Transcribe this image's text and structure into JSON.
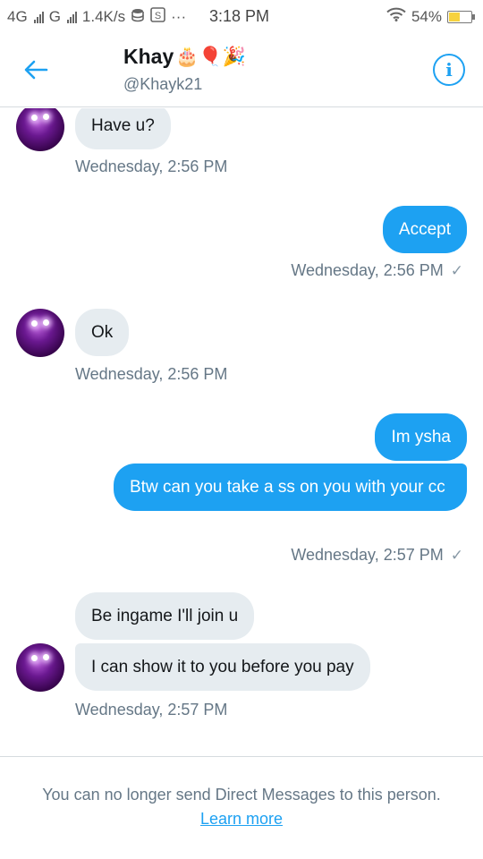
{
  "status_bar": {
    "network_1": "4G",
    "network_2": "G",
    "speed": "1.4K/s",
    "dots": "···",
    "time": "3:18 PM",
    "battery": "54%",
    "battery_level": 0.54
  },
  "header": {
    "name": "Khay",
    "name_emojis": "🎂🎈🎉",
    "handle": "@Khayk21"
  },
  "messages": [
    {
      "direction": "in",
      "text": "Have u?"
    },
    {
      "direction": "in",
      "timestamp": "Wednesday, 2:56 PM"
    },
    {
      "direction": "out",
      "text": "Accept"
    },
    {
      "direction": "out",
      "timestamp": "Wednesday, 2:56 PM"
    },
    {
      "direction": "in",
      "text": "Ok"
    },
    {
      "direction": "in",
      "timestamp": "Wednesday, 2:56 PM"
    },
    {
      "direction": "out",
      "text": "Im ysha"
    },
    {
      "direction": "out",
      "text": "Btw can you take a ss on you with your cc"
    },
    {
      "direction": "out",
      "timestamp": "Wednesday, 2:57 PM"
    },
    {
      "direction": "in",
      "text": "Be ingame I'll join u"
    },
    {
      "direction": "in",
      "text": "I can show it to you before you pay"
    },
    {
      "direction": "in",
      "timestamp": "Wednesday, 2:57 PM"
    }
  ],
  "footer": {
    "notice": "You can no longer send Direct Messages to this person.",
    "learn_more": "Learn more"
  },
  "colors": {
    "accent": "#1da1f2",
    "incoming_bubble": "#e6ecf0",
    "secondary_text": "#657786"
  }
}
